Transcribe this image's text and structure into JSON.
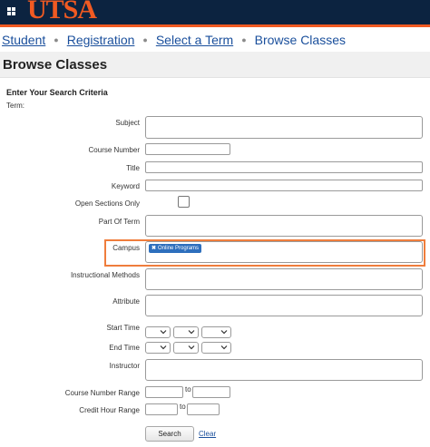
{
  "header": {
    "logo_text": "UTSA",
    "brand_colors": {
      "navy": "#0c2340",
      "orange": "#f15a22"
    }
  },
  "breadcrumb": {
    "items": [
      "Student",
      "Registration",
      "Select a Term",
      "Browse Classes"
    ]
  },
  "page": {
    "title": "Browse Classes",
    "section_title": "Enter Your Search Criteria",
    "term_label": "Term:"
  },
  "form": {
    "subject_label": "Subject",
    "course_number_label": "Course Number",
    "title_label": "Title",
    "keyword_label": "Keyword",
    "open_sections_label": "Open Sections Only",
    "open_sections_checked": false,
    "part_of_term_label": "Part Of Term",
    "campus_label": "Campus",
    "campus_selected": [
      "Online Programs"
    ],
    "instructional_methods_label": "Instructional Methods",
    "attribute_label": "Attribute",
    "start_time_label": "Start Time",
    "end_time_label": "End Time",
    "instructor_label": "Instructor",
    "course_number_range_label": "Course Number Range",
    "credit_hour_range_label": "Credit Hour Range",
    "range_to": "to"
  },
  "actions": {
    "search_label": "Search",
    "clear_label": "Clear"
  },
  "highlight_color": "#ef7d3c"
}
